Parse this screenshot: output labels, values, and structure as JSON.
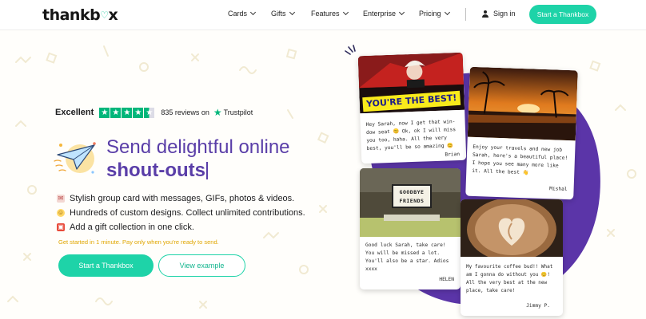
{
  "header": {
    "logo_text": "thankb",
    "logo_text_end": "x",
    "nav": [
      {
        "label": "Cards"
      },
      {
        "label": "Gifts"
      },
      {
        "label": "Features"
      },
      {
        "label": "Enterprise"
      },
      {
        "label": "Pricing"
      }
    ],
    "signin_label": "Sign in",
    "cta_label": "Start a Thankbox"
  },
  "trustpilot": {
    "rating_word": "Excellent",
    "stars": 4.5,
    "reviews": "835 reviews on",
    "brand": "Trustpilot"
  },
  "hero": {
    "headline_line1": "Send delightful online",
    "headline_line2": "shout-outs",
    "bullets": [
      {
        "icon": "card-icon",
        "text": "Stylish group card with messages, GIFs, photos & videos."
      },
      {
        "icon": "smiley-icon",
        "text": "Hundreds of custom designs. Collect unlimited contributions."
      },
      {
        "icon": "gift-icon",
        "text": "Add a gift collection in one click."
      }
    ],
    "tagline": "Get started in 1 minute. Pay only when you're ready to send.",
    "primary_button": "Start a Thankbox",
    "secondary_button": "View example"
  },
  "cards": [
    {
      "banner": "YOU'RE THE BEST!",
      "message": "Hey Sarah, now I get that win- dow seat 😊 Ok, ok I will miss you too, haha. All the very best, you'll be so amazing 😊",
      "signature": "Brian"
    },
    {
      "message": "Enjoy your travels and new job Sarah, here's a beautiful place! I hope you see many more like it. All the best 👋",
      "signature": "Mishal"
    },
    {
      "sign_text": "GOODBYE FRIENDS",
      "message": "Good luck Sarah, take care! You will be missed a lot. You'll also be a star. Adios xxxx",
      "signature": "HELEN"
    },
    {
      "message": "My favourite coffee bud!! What am I gonna do without you 😊! All the very best at the new place, take care!",
      "signature": "Jimmy P."
    }
  ],
  "colors": {
    "accent": "#1ed3a8",
    "headline": "#5a3ea8",
    "blob": "#5b35a8",
    "tagline": "#e0a600",
    "trustpilot": "#00b67a"
  }
}
